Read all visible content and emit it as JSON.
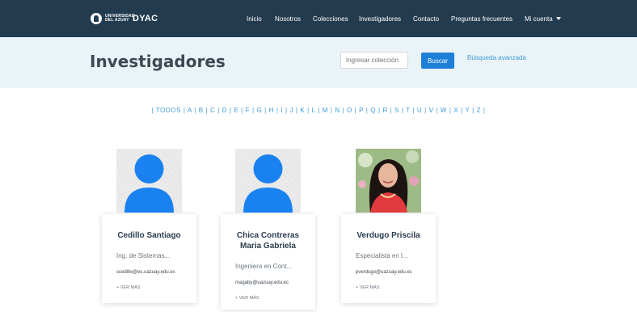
{
  "header": {
    "logo_text": "UNIVERSIDAD DEL AZUAY",
    "brand": "DYAC",
    "nav": [
      "Inicio",
      "Nosotros",
      "Colecciones",
      "Investigadores",
      "Contacto",
      "Preguntas frecuentes"
    ],
    "account_label": "Mi cuenta"
  },
  "hero": {
    "title": "Investigadores",
    "search_placeholder": "Ingresar colección",
    "search_button": "Buscar",
    "advanced_link": "Búsqueda avanzada"
  },
  "alphabet": "| TODOS | A | B | C | D | E | F | G | H | I | J | K | L | M | N | O | P | Q | R | S | T | U | V | W | X | Y | Z |",
  "researchers": [
    {
      "name": "Cedillo Santiago",
      "role": "Ing. de Sistemas...",
      "email": "scedillo@es.uazuay.edu.ec",
      "more": "+ VER MÁS",
      "photo": "avatar-icon"
    },
    {
      "name": "Chica Contreras Maria Gabriela",
      "role": "Ingeniera en Cont...",
      "email": "magaby@uazuay.edu.ec",
      "more": "+ VER MÁS",
      "photo": "avatar-icon"
    },
    {
      "name": "Verdugo Priscila",
      "role": "Especialista en l...",
      "email": "pverdugo@uazuay.edu.ec",
      "more": "+ VER MÁS",
      "photo": "portrait-photo"
    }
  ],
  "colors": {
    "topbar": "#233b4f",
    "hero_bg": "#eaf3f8",
    "accent": "#1e7fd7",
    "link": "#3e9bd8"
  }
}
